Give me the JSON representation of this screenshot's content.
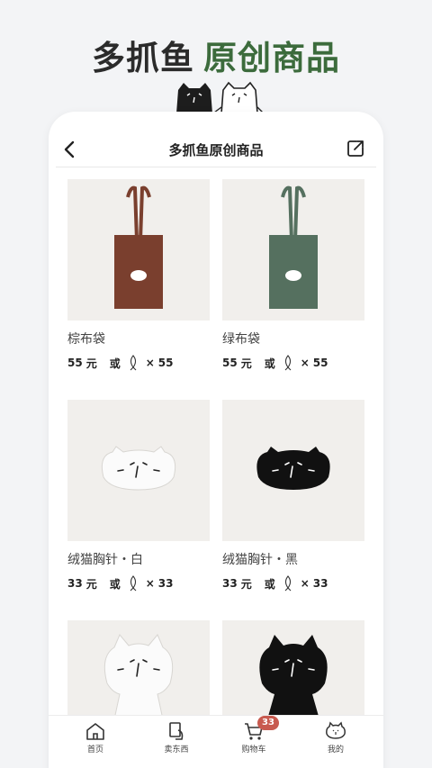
{
  "hero": {
    "title_part1": "多抓鱼",
    "title_part2": "原创商品"
  },
  "navbar": {
    "title": "多抓鱼原创商品"
  },
  "products": [
    {
      "name": "棕布袋",
      "cash": "55",
      "unit": "元",
      "or": "或",
      "times": "×",
      "fish": "55",
      "image": "brown-tote-bag"
    },
    {
      "name": "绿布袋",
      "cash": "55",
      "unit": "元",
      "or": "或",
      "times": "×",
      "fish": "55",
      "image": "green-tote-bag"
    },
    {
      "name": "绒猫胸针・白",
      "cash": "33",
      "unit": "元",
      "or": "或",
      "times": "×",
      "fish": "33",
      "image": "white-cat-brooch"
    },
    {
      "name": "绒猫胸针・黑",
      "cash": "33",
      "unit": "元",
      "or": "或",
      "times": "×",
      "fish": "33",
      "image": "black-cat-brooch"
    },
    {
      "image": "white-cat-plush"
    },
    {
      "image": "black-cat-plush"
    }
  ],
  "tabbar": {
    "items": [
      {
        "label": "首页",
        "icon": "home-icon"
      },
      {
        "label": "卖东西",
        "icon": "sell-icon"
      },
      {
        "label": "购物车",
        "icon": "cart-icon",
        "badge": "33"
      },
      {
        "label": "我的",
        "icon": "cat-profile-icon"
      }
    ]
  },
  "colors": {
    "accent_green": "#3c6b3c",
    "badge_red": "#c85a4f",
    "tote_brown": "#7a3f2e",
    "tote_green": "#55705f"
  }
}
